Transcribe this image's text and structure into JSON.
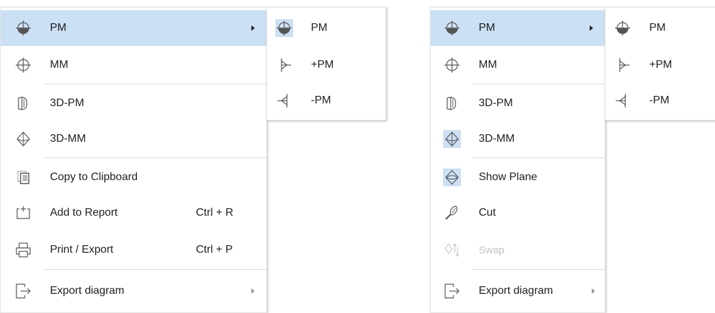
{
  "left_menu": {
    "items": [
      {
        "label": "PM",
        "icon": "crosshair-circle-icon",
        "has_submenu": true
      },
      {
        "label": "MM",
        "icon": "crosshair-circle-icon"
      },
      {
        "label": "3D-PM",
        "icon": "3d-pm-icon"
      },
      {
        "label": "3D-MM",
        "icon": "3d-mm-icon"
      },
      {
        "label": "Copy to Clipboard",
        "icon": "clipboard-icon"
      },
      {
        "label": "Add to Report",
        "icon": "add-to-report-icon",
        "shortcut": "Ctrl + R"
      },
      {
        "label": "Print / Export",
        "icon": "printer-icon",
        "shortcut": "Ctrl + P"
      },
      {
        "label": "Export diagram",
        "icon": "export-icon",
        "has_submenu": true
      }
    ]
  },
  "left_submenu": {
    "items": [
      {
        "label": "PM",
        "icon": "crosshair-circle-icon"
      },
      {
        "label": "+PM",
        "icon": "half-plus-icon"
      },
      {
        "label": "-PM",
        "icon": "half-minus-icon"
      }
    ]
  },
  "right_menu": {
    "items": [
      {
        "label": "PM",
        "icon": "crosshair-circle-icon",
        "has_submenu": true
      },
      {
        "label": "MM",
        "icon": "crosshair-circle-icon"
      },
      {
        "label": "3D-PM",
        "icon": "3d-pm-icon"
      },
      {
        "label": "3D-MM",
        "icon": "3d-mm-icon"
      },
      {
        "label": "Show Plane",
        "icon": "show-plane-icon"
      },
      {
        "label": "Cut",
        "icon": "cut-knife-icon"
      },
      {
        "label": "Swap",
        "icon": "swap-icon",
        "disabled": true
      },
      {
        "label": "Export diagram",
        "icon": "export-icon",
        "has_submenu": true
      }
    ]
  },
  "right_submenu": {
    "items": [
      {
        "label": "PM",
        "icon": "crosshair-circle-icon"
      },
      {
        "label": "+PM",
        "icon": "half-plus-icon"
      },
      {
        "label": "-PM",
        "icon": "half-minus-icon"
      }
    ]
  },
  "colors": {
    "highlight": "#cce0f5",
    "separator": "#d9d9d9",
    "disabled_text": "#c2c2c2"
  }
}
